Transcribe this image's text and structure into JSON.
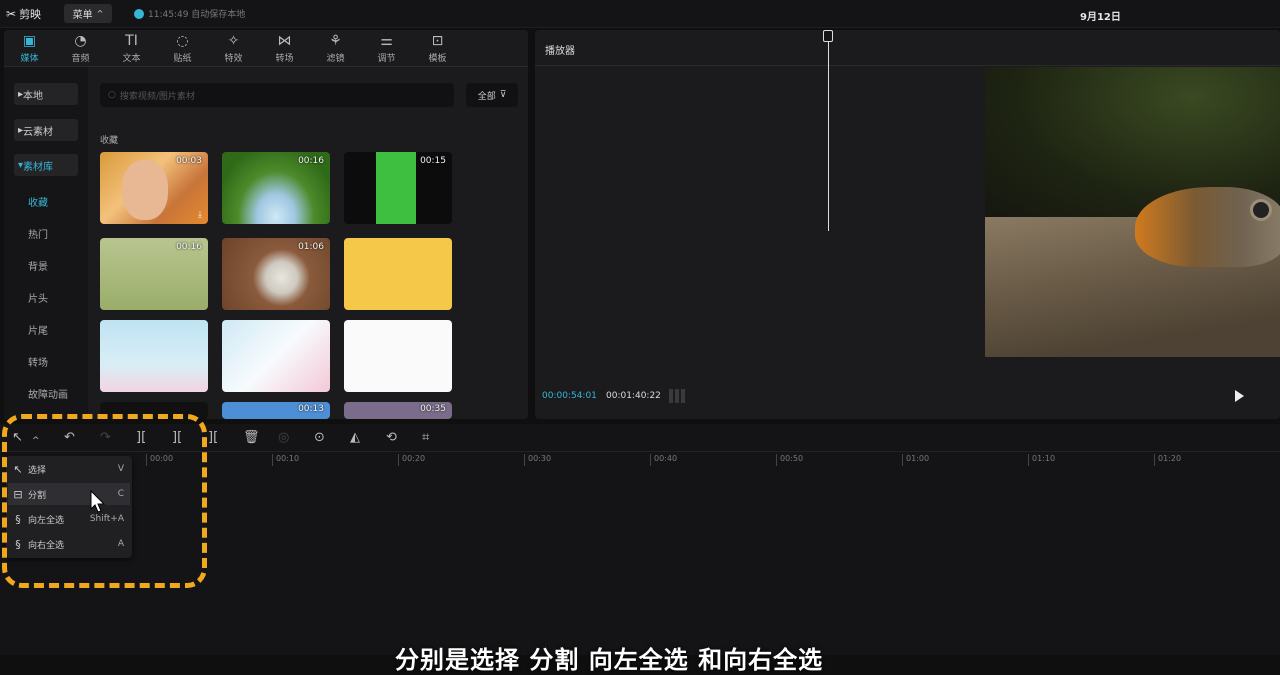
{
  "app": {
    "name": "剪映",
    "menu_label": "菜单",
    "save_status": "11:45:49 自动保存本地",
    "date": "9月12日"
  },
  "toolbar": {
    "items": [
      {
        "label": "媒体",
        "icon": "media-icon"
      },
      {
        "label": "音频",
        "icon": "audio-icon"
      },
      {
        "label": "文本",
        "icon": "text-icon"
      },
      {
        "label": "贴纸",
        "icon": "sticker-icon"
      },
      {
        "label": "特效",
        "icon": "effects-icon"
      },
      {
        "label": "转场",
        "icon": "transition-icon"
      },
      {
        "label": "滤镜",
        "icon": "filter-icon"
      },
      {
        "label": "调节",
        "icon": "adjust-icon"
      },
      {
        "label": "模板",
        "icon": "template-icon"
      }
    ]
  },
  "sidebar": {
    "items": [
      "本地",
      "云素材",
      "素材库"
    ],
    "sub_items": [
      "收藏",
      "热门",
      "背景",
      "片头",
      "片尾",
      "转场",
      "故障动画"
    ]
  },
  "library": {
    "search_placeholder": "搜索视频/图片素材",
    "filter_label": "全部",
    "section_title": "收藏",
    "thumbs": [
      {
        "duration": "00:03"
      },
      {
        "duration": "00:16"
      },
      {
        "duration": "00:15"
      },
      {
        "duration": "00:16"
      },
      {
        "duration": "01:06"
      },
      {
        "duration": ""
      },
      {
        "duration": ""
      },
      {
        "duration": ""
      },
      {
        "duration": ""
      },
      {
        "duration": ""
      },
      {
        "duration": "00:13"
      },
      {
        "duration": "00:35"
      }
    ]
  },
  "player": {
    "title": "播放器",
    "time_current": "00:00:54:01",
    "time_total": "00:01:40:22"
  },
  "timeline": {
    "ruler": [
      "00:00",
      "00:10",
      "00:20",
      "00:30",
      "00:40",
      "00:50",
      "01:00",
      "01:10",
      "01:20"
    ]
  },
  "dropdown": {
    "items": [
      {
        "label": "选择",
        "key": "V"
      },
      {
        "label": "分割",
        "key": "C"
      },
      {
        "label": "向左全选",
        "key": "Shift+A"
      },
      {
        "label": "向右全选",
        "key": "A"
      }
    ]
  },
  "subtitle": "分别是选择 分割 向左全选 和向右全选",
  "colors": {
    "accent": "#35b6d6",
    "highlight": "#f0a81e"
  }
}
